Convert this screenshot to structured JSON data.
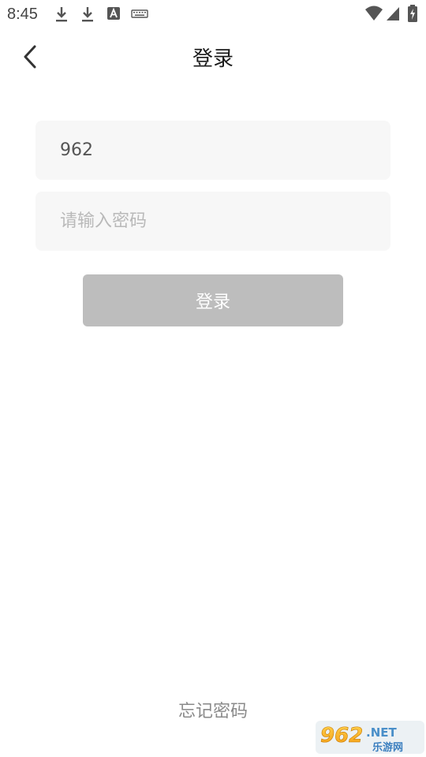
{
  "status_bar": {
    "time": "8:45"
  },
  "header": {
    "title": "登录",
    "back_icon": "chevron-left-icon"
  },
  "form": {
    "username_value": "962",
    "password_placeholder": "请输入密码",
    "login_label": "登录"
  },
  "footer": {
    "forgot_password_label": "忘记密码"
  },
  "watermark": {
    "brand": "962.NET",
    "sub": "乐游网"
  },
  "colors": {
    "field_background": "#f7f7f7",
    "button_disabled": "#bdbdbd",
    "link_text": "#8a8a8a"
  }
}
